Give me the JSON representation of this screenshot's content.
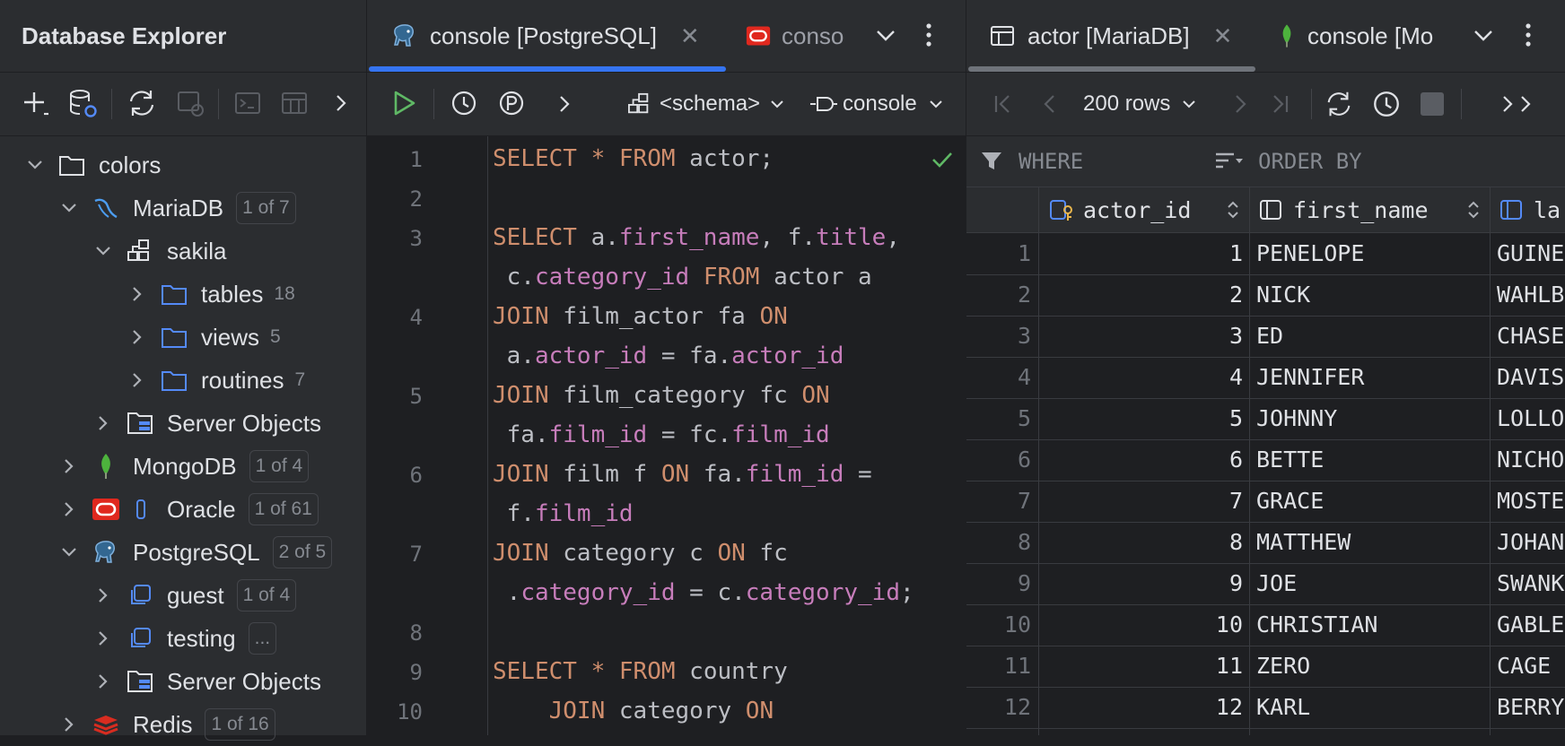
{
  "explorer": {
    "title": "Database Explorer",
    "tree": [
      {
        "label": "colors",
        "icon": "folder-icon"
      },
      {
        "label": "MariaDB",
        "badge": "1 of 7",
        "icon": "mariadb-icon"
      },
      {
        "label": "sakila",
        "icon": "schema-icon"
      },
      {
        "label": "tables",
        "count": "18",
        "icon": "folder-icon"
      },
      {
        "label": "views",
        "count": "5",
        "icon": "folder-icon"
      },
      {
        "label": "routines",
        "count": "7",
        "icon": "folder-icon"
      },
      {
        "label": "Server Objects",
        "icon": "server-objects-icon"
      },
      {
        "label": "MongoDB",
        "badge": "1 of 4",
        "icon": "mongodb-icon"
      },
      {
        "label": "Oracle",
        "badge": "1 of 61",
        "icon": "oracle-icon"
      },
      {
        "label": "PostgreSQL",
        "badge": "2 of 5",
        "icon": "postgresql-icon"
      },
      {
        "label": "guest",
        "badge": "1 of 4",
        "icon": "schema-icon"
      },
      {
        "label": "testing",
        "badge": "...",
        "icon": "schema-icon"
      },
      {
        "label": "Server Objects",
        "icon": "server-objects-icon"
      },
      {
        "label": "Redis",
        "badge": "1 of 16",
        "icon": "redis-icon"
      }
    ]
  },
  "editor": {
    "tabs": [
      {
        "label": "console [PostgreSQL]",
        "close": "✕"
      },
      {
        "label": "conso"
      }
    ],
    "schema_selector": "<schema>",
    "session_selector": "console",
    "line_numbers": [
      "1",
      "2",
      "3",
      "4",
      "5",
      "6",
      "7",
      "8",
      "9",
      "10"
    ]
  },
  "results": {
    "tabs": [
      {
        "label": "actor [MariaDB]",
        "close": "✕"
      },
      {
        "label": "console [Mo"
      }
    ],
    "rows_selector": "200 rows",
    "where_label": "WHERE",
    "order_label": "ORDER BY",
    "columns": [
      "actor_id",
      "first_name",
      "la"
    ],
    "rows": [
      {
        "n": "1",
        "id": "1",
        "first": "PENELOPE",
        "last": "GUINE"
      },
      {
        "n": "2",
        "id": "2",
        "first": "NICK",
        "last": "WAHLB"
      },
      {
        "n": "3",
        "id": "3",
        "first": "ED",
        "last": "CHASE"
      },
      {
        "n": "4",
        "id": "4",
        "first": "JENNIFER",
        "last": "DAVIS"
      },
      {
        "n": "5",
        "id": "5",
        "first": "JOHNNY",
        "last": "LOLLO"
      },
      {
        "n": "6",
        "id": "6",
        "first": "BETTE",
        "last": "NICHO"
      },
      {
        "n": "7",
        "id": "7",
        "first": "GRACE",
        "last": "MOSTE"
      },
      {
        "n": "8",
        "id": "8",
        "first": "MATTHEW",
        "last": "JOHAN"
      },
      {
        "n": "9",
        "id": "9",
        "first": "JOE",
        "last": "SWANK"
      },
      {
        "n": "10",
        "id": "10",
        "first": "CHRISTIAN",
        "last": "GABLE"
      },
      {
        "n": "11",
        "id": "11",
        "first": "ZERO",
        "last": "CAGE"
      },
      {
        "n": "12",
        "id": "12",
        "first": "KARL",
        "last": "BERRY"
      }
    ]
  },
  "colors": {
    "accent": "#3574f0",
    "keyword": "#cf8e6d",
    "field": "#c77dbb",
    "run": "#5fb865"
  }
}
